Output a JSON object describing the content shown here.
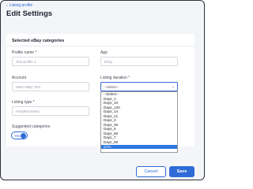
{
  "header": {
    "back_label": "Listing profile",
    "title": "Edit Settings"
  },
  "section": {
    "title": "Selected eBay categories"
  },
  "fields": {
    "profile_name": {
      "label": "Profile name *",
      "placeholder": "Test profile 1"
    },
    "app": {
      "label": "App",
      "placeholder": "Ebay"
    },
    "account": {
      "label": "Account",
      "placeholder": "Mark eBay Test"
    },
    "listing_duration": {
      "label": "Listing duration *",
      "value": "--Select--"
    },
    "listing_type": {
      "label": "Listing type *",
      "placeholder": "FixedPriceItem"
    },
    "suggested_categories": {
      "label": "Suggested categories",
      "toggle_text": "Yes"
    }
  },
  "dropdown_options": [
    "--Select--",
    "Days_1",
    "Days_10",
    "Days_120",
    "Days_14",
    "Days_21",
    "Days_3",
    "Days_30",
    "Days_5",
    "Days_60",
    "Days_7",
    "Days_90",
    "GTC"
  ],
  "dropdown_selected": "GTC",
  "buttons": {
    "cancel": "Cancel",
    "save": "Save"
  },
  "colors": {
    "accent": "#2e6bd6",
    "selected_option": "#2f78e0"
  }
}
